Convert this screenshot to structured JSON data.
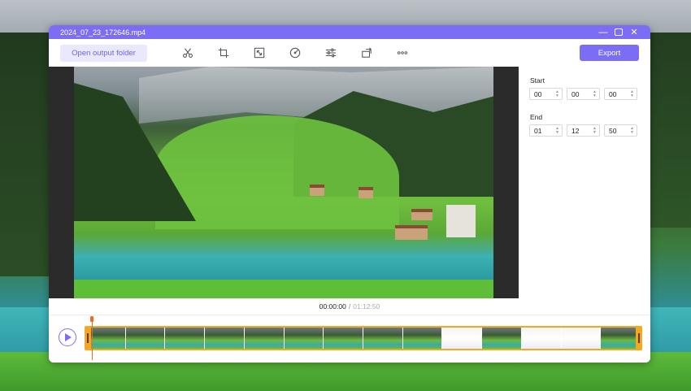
{
  "window": {
    "title": "2024_07_23_172646.mp4",
    "controls": {
      "minimize": "—",
      "close": "✕"
    }
  },
  "toolbar": {
    "open_folder_label": "Open output folder",
    "tools": [
      {
        "icon": "scissors-icon"
      },
      {
        "icon": "crop-icon"
      },
      {
        "icon": "resize-icon"
      },
      {
        "icon": "speed-icon"
      },
      {
        "icon": "adjust-icon"
      },
      {
        "icon": "rotate-icon"
      },
      {
        "icon": "more-icon"
      }
    ],
    "export_label": "Export"
  },
  "trim": {
    "start_label": "Start",
    "start": {
      "h": "00",
      "m": "00",
      "s": "00"
    },
    "end_label": "End",
    "end": {
      "h": "01",
      "m": "12",
      "s": "50"
    }
  },
  "playback": {
    "current_time": "00:00:00",
    "separator": "/",
    "duration": "01:12:50"
  },
  "colors": {
    "accent": "#7b6ef5",
    "trim_handle": "#f5a623",
    "playhead": "#f06a1d"
  }
}
